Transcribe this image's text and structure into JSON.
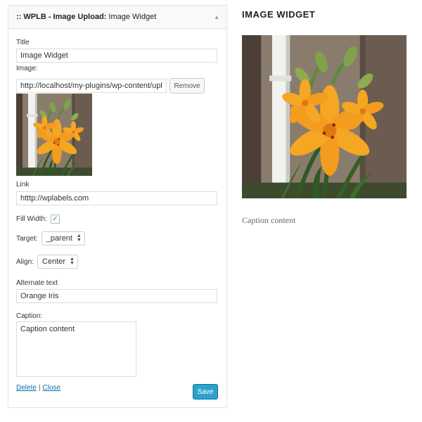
{
  "widget": {
    "title_prefix": ":: WPLB - Image Upload:",
    "title_name": "Image Widget",
    "toggle_icon": "arrow-up-icon"
  },
  "form": {
    "title_label": "Title",
    "title_value": "Image Widget",
    "image_label": "Image:",
    "image_value": "http://localhost/my-plugins/wp-content/uplo",
    "remove_label": "Remove",
    "link_label": "Link",
    "link_value": "htttp://wplabels.com",
    "fill_width_label": "Fill Width:",
    "fill_width_checked": true,
    "target_label": "Target:",
    "target_value": "_parent",
    "align_label": "Align:",
    "align_value": "Center",
    "alt_label": "Alternate text",
    "alt_value": "Orange Iris",
    "caption_label": "Caption:",
    "caption_value": "Caption content",
    "delete_label": "Delete",
    "separator": "|",
    "close_label": "Close",
    "save_label": "Save"
  },
  "preview": {
    "heading": "IMAGE WIDGET",
    "caption": "Caption content"
  },
  "colors": {
    "link": "#0073aa",
    "save_button": "#2ea2cc",
    "checkbox_check": "#1e8cbe"
  }
}
